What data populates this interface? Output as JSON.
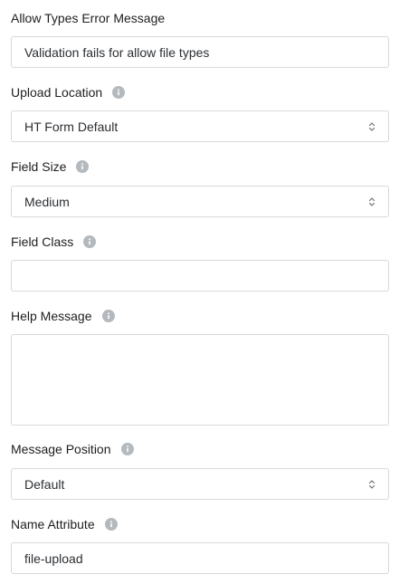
{
  "fields": {
    "allow_types_error": {
      "label": "Allow Types Error Message",
      "value": "Validation fails for allow file types"
    },
    "upload_location": {
      "label": "Upload Location",
      "value": "HT Form Default"
    },
    "field_size": {
      "label": "Field Size",
      "value": "Medium"
    },
    "field_class": {
      "label": "Field Class",
      "value": ""
    },
    "help_message": {
      "label": "Help Message",
      "value": ""
    },
    "message_position": {
      "label": "Message Position",
      "value": "Default"
    },
    "name_attribute": {
      "label": "Name Attribute",
      "value": "file-upload"
    }
  },
  "icons": {
    "info": "info-icon",
    "select_arrows": "chevron-up-down-icon"
  },
  "colors": {
    "info_icon_bg": "#b4b9be",
    "border": "#d5d9dd",
    "label": "#1e1e1e"
  }
}
